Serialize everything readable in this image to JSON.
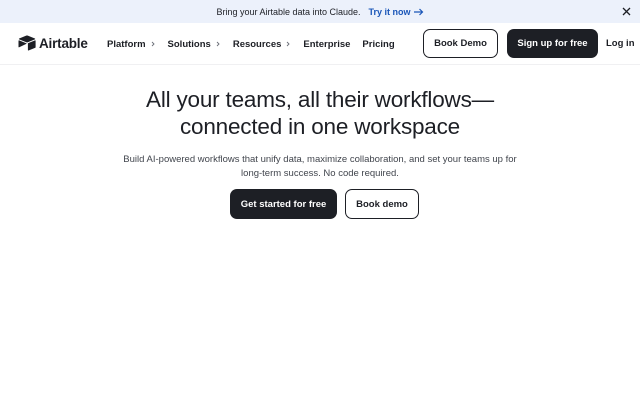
{
  "banner": {
    "text": "Bring your Airtable data into Claude.",
    "link_label": "Try it now",
    "link_icon": "arrow-right-icon",
    "close_icon": "close-icon"
  },
  "nav": {
    "logo_text": "Airtable",
    "logo_icon": "airtable-logo-icon",
    "items": [
      {
        "label": "Platform",
        "has_dropdown": true
      },
      {
        "label": "Solutions",
        "has_dropdown": true
      },
      {
        "label": "Resources",
        "has_dropdown": true
      },
      {
        "label": "Enterprise",
        "has_dropdown": false
      },
      {
        "label": "Pricing",
        "has_dropdown": false
      }
    ],
    "book_demo_label": "Book Demo",
    "signup_label": "Sign up for free",
    "login_label": "Log in"
  },
  "hero": {
    "title_line1": "All your teams, all their workflows—",
    "title_line2": "connected in one workspace",
    "subtitle": "Build AI-powered workflows that unify data, maximize collaboration, and set your teams up for long-term success. No code required.",
    "primary_cta": "Get started for free",
    "secondary_cta": "Book demo"
  },
  "colors": {
    "banner_bg": "#ecf1fb",
    "link": "#1a56b8",
    "dark": "#1d1f25",
    "text_muted": "#41454d"
  }
}
